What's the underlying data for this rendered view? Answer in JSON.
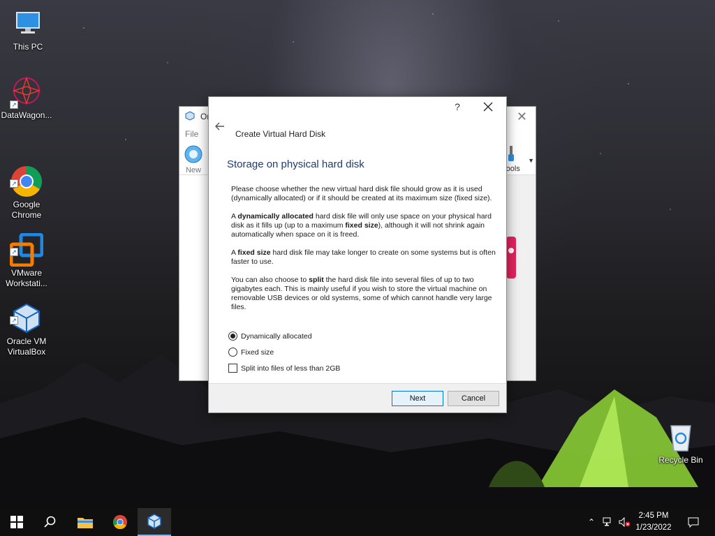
{
  "desktop": {
    "icons": [
      {
        "label": "This PC"
      },
      {
        "label": "DataWagon..."
      },
      {
        "label": "Google\nChrome"
      },
      {
        "label": "VMware\nWorkstati..."
      },
      {
        "label": "Oracle VM\nVirtualBox"
      }
    ],
    "recycle_bin": {
      "label": "Recycle Bin"
    }
  },
  "background_window": {
    "title": "Or",
    "menu_file": "File",
    "new_label": "New",
    "tools_label": "Tools"
  },
  "dialog": {
    "help": "?",
    "header_title": "Create Virtual Hard Disk",
    "heading": "Storage on physical hard disk",
    "paragraphs": {
      "p1": "Please choose whether the new virtual hard disk file should grow as it is used (dynamically allocated) or if it should be created at its maximum size (fixed size).",
      "p2_a": "A ",
      "p2_b": "dynamically allocated",
      "p2_c": " hard disk file will only use space on your physical hard disk as it fills up (up to a maximum ",
      "p2_d": "fixed size",
      "p2_e": "), although it will not shrink again automatically when space on it is freed.",
      "p3_a": "A ",
      "p3_b": "fixed size",
      "p3_c": " hard disk file may take longer to create on some systems but is often faster to use.",
      "p4_a": "You can also choose to ",
      "p4_b": "split",
      "p4_c": " the hard disk file into several files of up to two gigabytes each. This is mainly useful if you wish to store the virtual machine on removable USB devices or old systems, some of which cannot handle very large files."
    },
    "options": {
      "dynamic": "Dynamically allocated",
      "fixed": "Fixed size",
      "split": "Split into files of less than 2GB"
    },
    "selected": "dynamic",
    "buttons": {
      "next": "Next",
      "cancel": "Cancel"
    }
  },
  "taskbar": {
    "time": "2:45 PM",
    "date": "1/23/2022",
    "accent": "#77b7f0"
  }
}
